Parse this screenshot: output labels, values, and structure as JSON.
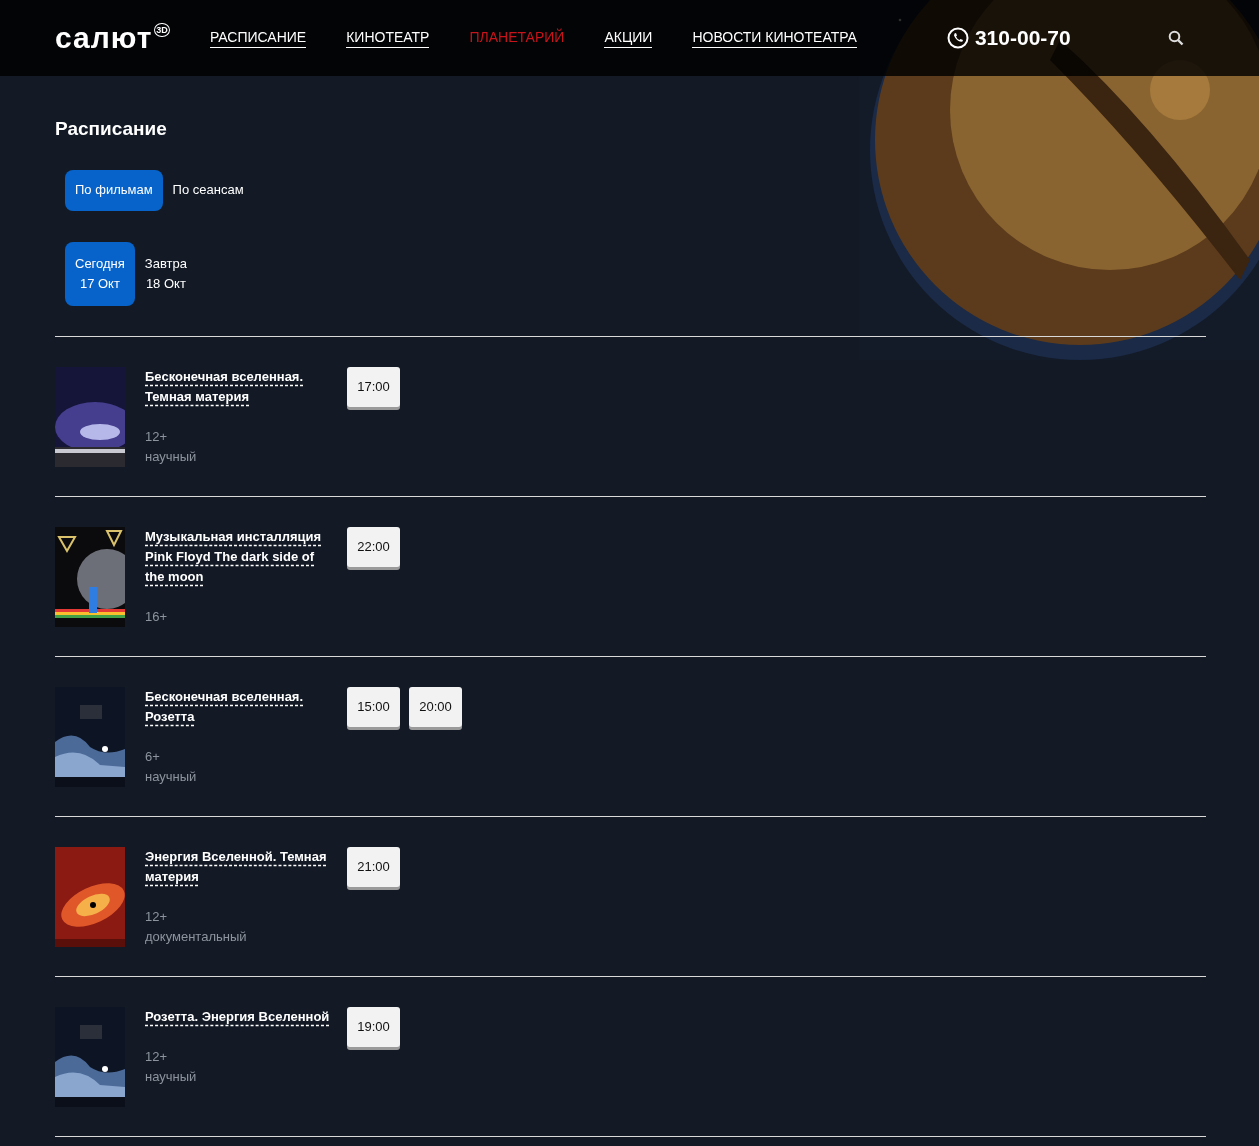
{
  "header": {
    "logo": {
      "text": "салют",
      "badge": "3D"
    },
    "nav": [
      {
        "label": "РАСПИСАНИЕ",
        "selected": false
      },
      {
        "label": "КИНОТЕАТР",
        "selected": false
      },
      {
        "label": "ПЛАНЕТАРИЙ",
        "selected": true
      },
      {
        "label": "АКЦИИ",
        "selected": false
      },
      {
        "label": "НОВОСТИ КИНОТЕАТРА",
        "selected": false
      }
    ],
    "phone": "310-00-70"
  },
  "title": "Расписание",
  "view_tabs": [
    {
      "label": "По фильмам",
      "selected": true
    },
    {
      "label": "По сеансам",
      "selected": false
    }
  ],
  "date_tabs": [
    {
      "day": "Сегодня",
      "date": "17 Окт",
      "selected": true
    },
    {
      "day": "Завтра",
      "date": "18 Окт",
      "selected": false
    }
  ],
  "movies": [
    {
      "poster": {
        "kind": "picture"
      },
      "title": "Бесконечная вселенная. Темная материя",
      "age": "12+",
      "genre": "научный",
      "times": [
        "17:00"
      ]
    },
    {
      "poster": {
        "kind": "picture"
      },
      "title": "Музыкальная инсталляция Pink Floyd The dark side of the moon",
      "age": "16+",
      "times": [
        "22:00"
      ]
    },
    {
      "poster": {
        "kind": "picture"
      },
      "title": "Бесконечная вселенная. Розетта",
      "age": "6+",
      "genre": "научный",
      "times": [
        "15:00",
        "20:00"
      ]
    },
    {
      "poster": {
        "kind": "picture"
      },
      "title": "Энергия Вселенной. Темная материя",
      "age": "12+",
      "genre": "документальный",
      "times": [
        "21:00"
      ]
    },
    {
      "poster": {
        "kind": "picture"
      },
      "title": "Розетта. Энергия Вселенной",
      "age": "12+",
      "genre": "научный",
      "times": [
        "19:00"
      ]
    }
  ]
}
